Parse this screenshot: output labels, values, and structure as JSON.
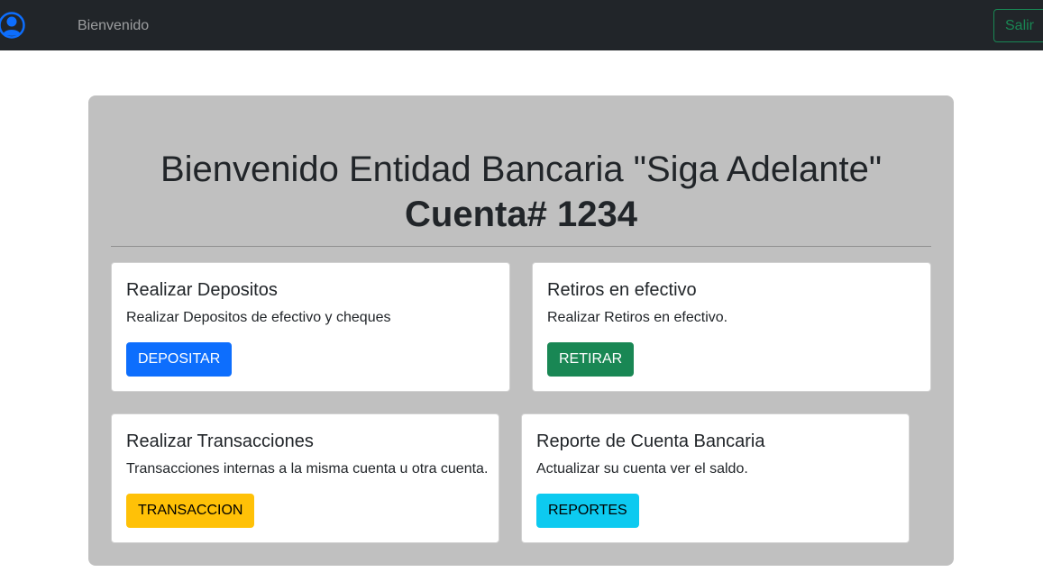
{
  "navbar": {
    "brand_link": "Bienvenido",
    "logout_label": "Salir"
  },
  "hero": {
    "title": "Bienvenido Entidad Bancaria \"Siga Adelante\"",
    "account": "Cuenta# 1234"
  },
  "cards": [
    {
      "title": "Realizar Depositos",
      "text": "Realizar Depositos de efectivo y cheques",
      "button": "DEPOSITAR"
    },
    {
      "title": "Retiros en efectivo",
      "text": "Realizar Retiros en efectivo.",
      "button": "RETIRAR"
    },
    {
      "title": "Realizar Transacciones",
      "text": "Transacciones internas a la misma cuenta u otra cuenta.",
      "button": "TRANSACCION"
    },
    {
      "title": "Reporte de Cuenta Bancaria",
      "text": "Actualizar su cuenta ver el saldo.",
      "button": "REPORTES"
    }
  ],
  "colors": {
    "navbar": "#212529",
    "jumbotron": "#c0c0c0",
    "primary": "#0d6efd",
    "success": "#198754",
    "warning": "#ffc107",
    "info": "#0dcaf0",
    "avatar": "#0d6efd"
  },
  "icons": {
    "avatar": "user-circle-icon"
  }
}
